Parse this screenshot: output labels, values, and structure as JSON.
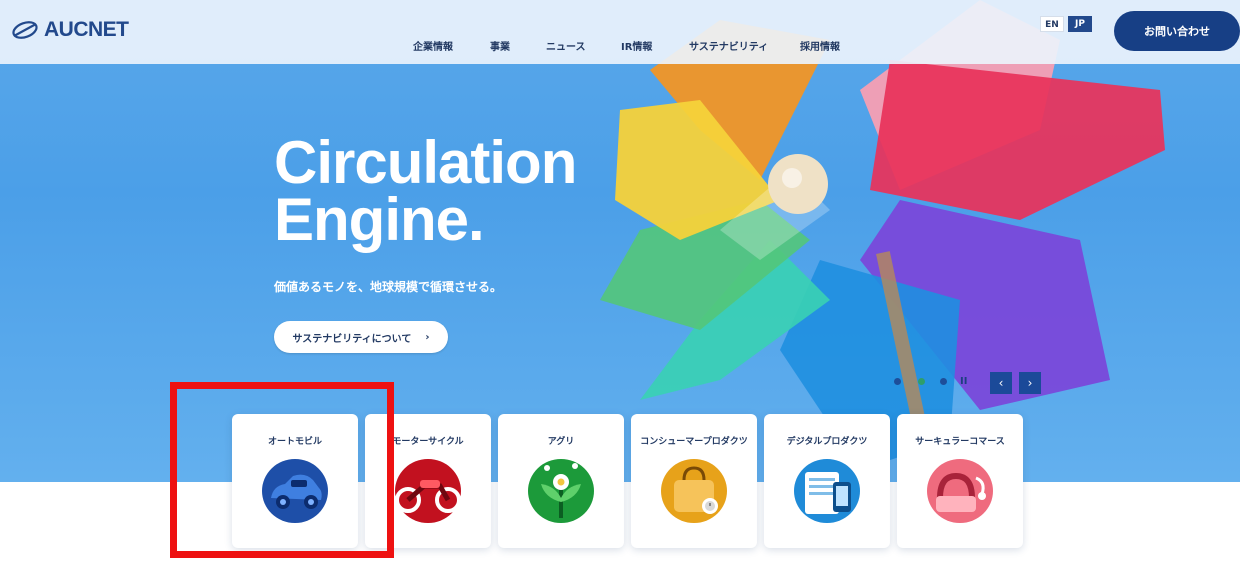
{
  "header": {
    "logo_text": "AUCNET",
    "nav": [
      "企業情報",
      "事業",
      "ニュース",
      "IR情報",
      "サステナビリティ",
      "採用情報"
    ],
    "lang": {
      "en": "EN",
      "jp": "JP",
      "active": "JP"
    },
    "contact_label": "お問い合わせ"
  },
  "hero": {
    "title_line1": "Circulation",
    "title_line2": "Engine.",
    "subtitle": "価値あるモノを、地球規模で循環させる。",
    "button_label": "サステナビリティについて",
    "button_arrow": "›",
    "slider": {
      "dots": 3,
      "active_dot": 2,
      "pause_symbol": "II",
      "prev": "‹",
      "next": "›"
    }
  },
  "categories": [
    {
      "label": "オートモビル",
      "icon": "car-icon",
      "color": "#1e4fa8"
    },
    {
      "label": "モーターサイクル",
      "icon": "motorcycle-icon",
      "color": "#c2111f"
    },
    {
      "label": "アグリ",
      "icon": "flower-icon",
      "color": "#1c9a3a"
    },
    {
      "label": "コンシューマープロダクツ",
      "icon": "handbag-icon",
      "color": "#e7a21a"
    },
    {
      "label": "デジタルプロダクツ",
      "icon": "devices-icon",
      "color": "#1f8bd8"
    },
    {
      "label": "サーキュラーコマース",
      "icon": "stethoscope-icon",
      "color": "#ef6b7e"
    }
  ],
  "colors": {
    "brand": "#22498c",
    "contact_bg": "#173f85",
    "highlight": "#ee1111",
    "sky": "#4b9fe8"
  }
}
